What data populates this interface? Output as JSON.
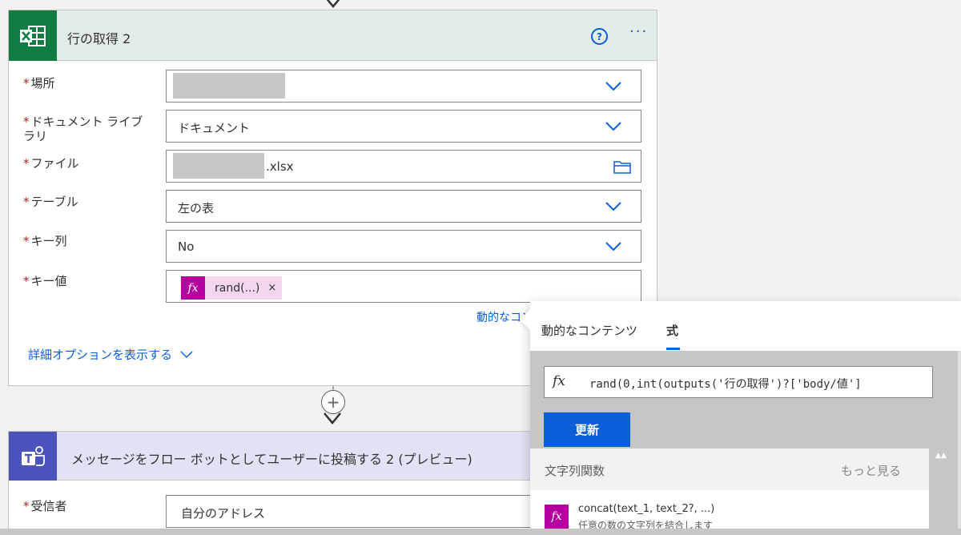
{
  "card1": {
    "title": "行の取得 2",
    "help_label": "?",
    "more_label": "···",
    "fields": {
      "location": {
        "label": "場所",
        "required": "*"
      },
      "library": {
        "label_line1": "ドキュメント ライブ",
        "label_line2": "ラリ",
        "required": "*",
        "value": "ドキュメント"
      },
      "file": {
        "label": "ファイル",
        "required": "*",
        "value_suffix": ".xlsx"
      },
      "table": {
        "label": "テーブル",
        "required": "*",
        "value": "左の表"
      },
      "key_column": {
        "label": "キー列",
        "required": "*",
        "value": "No"
      },
      "key_value": {
        "label": "キー値",
        "required": "*",
        "token_text": "rand(...)",
        "token_remove": "×",
        "token_fx": "fx"
      }
    },
    "dynamic_link": "動的なコンテンツの追加",
    "advanced_link": "詳細オプションを表示する"
  },
  "connector": {
    "plus": "+"
  },
  "card2": {
    "title": "メッセージをフロー ボットとしてユーザーに投稿する 2 (プレビュー)",
    "recipient": {
      "label": "受信者",
      "required": "*",
      "value": "自分のアドレス"
    }
  },
  "popup": {
    "tabs": [
      "動的なコンテンツ",
      "式"
    ],
    "fx_label": "fx",
    "expression": "rand(0,int(outputs('行の取得')?['body/値']",
    "update_button": "更新",
    "section_title": "文字列関数",
    "see_more": "もっと見る",
    "items": [
      {
        "name": "concat(text_1, text_2?, ...)",
        "description": "任意の数の文字列を結合します",
        "fx": "fx"
      }
    ],
    "scroll_up": "▲▲"
  },
  "colors": {
    "excel_green": "#107c41",
    "teams_purple": "#4b53bc",
    "accent_blue": "#0b5fd9",
    "expression_magenta": "#b4009e",
    "required_red": "#a4262c"
  }
}
